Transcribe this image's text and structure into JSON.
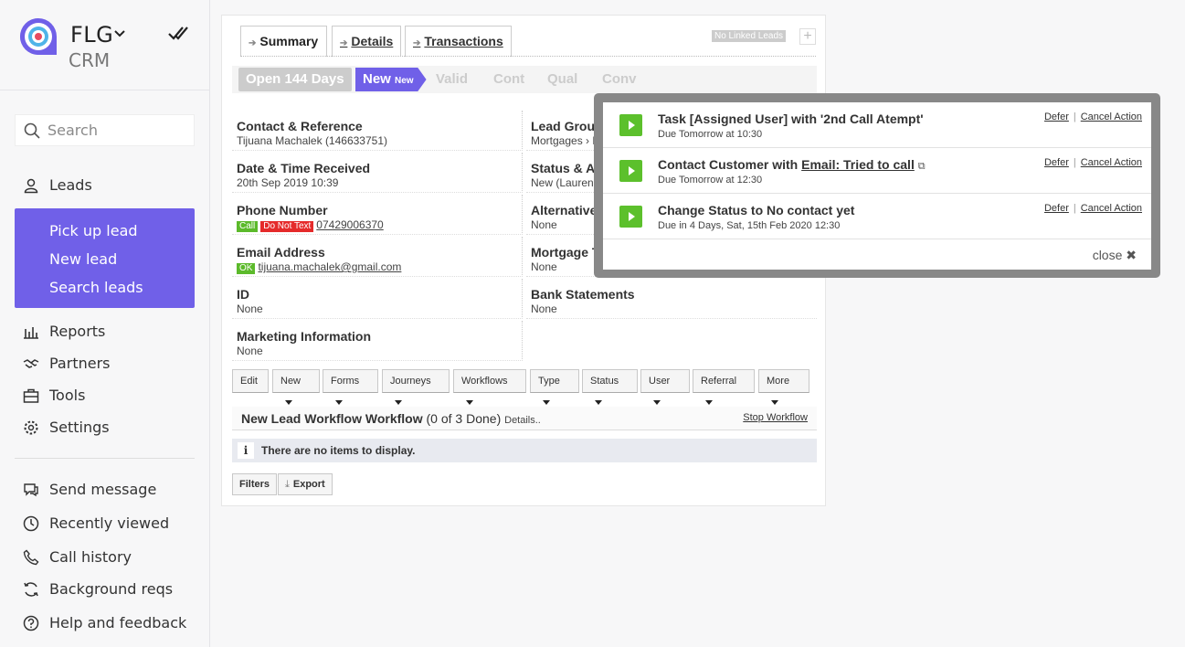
{
  "brand": {
    "name": "FLG",
    "sub": "CRM"
  },
  "search": {
    "placeholder": "Search"
  },
  "nav": {
    "leads": "Leads",
    "lead_items": [
      "Pick up lead",
      "New lead",
      "Search leads"
    ],
    "reports": "Reports",
    "partners": "Partners",
    "tools": "Tools",
    "settings": "Settings",
    "send_message": "Send message",
    "recently_viewed": "Recently viewed",
    "call_history": "Call history",
    "background_reqs": "Background reqs",
    "help": "Help and feedback"
  },
  "tabs": [
    "Summary",
    "Details",
    "Transactions"
  ],
  "no_linked": "No Linked Leads",
  "plus": "+",
  "stages": {
    "open": "Open 144 Days",
    "new": "New",
    "new_sub": "New",
    "others": [
      "Valid",
      "Cont",
      "Qual",
      "Conv"
    ]
  },
  "fields": {
    "contact_label": "Contact & Reference",
    "contact_value": "Tijuana Machalek (146633751)",
    "date_label": "Date & Time Received",
    "date_value": "20th Sep 2019 10:39",
    "phone_label": "Phone Number",
    "phone_call": "Call",
    "phone_dnt": "Do Not Text",
    "phone_value": "07429006370",
    "email_label": "Email Address",
    "email_ok": "OK",
    "email_value": "tijuana.machalek@gmail.com",
    "id_label": "ID",
    "id_value": "None",
    "marketing_label": "Marketing Information",
    "marketing_value": "None",
    "group_label": "Lead Group",
    "group_value": "Mortgages › Mo",
    "status_label": "Status & As",
    "status_value": "New (Lauren S",
    "alt_label": "Alternative P",
    "alt_value": "None",
    "mortgage_label": "Mortgage Ty",
    "mortgage_value": "None",
    "bank_label": "Bank Statements",
    "bank_value": "None"
  },
  "buttons": [
    "Edit",
    "New",
    "Forms",
    "Journeys",
    "Workflows",
    "Type",
    "Status",
    "User",
    "Referral",
    "More"
  ],
  "workflow": {
    "title": "New Lead Workflow Workflow",
    "count": "(0 of 3 Done)",
    "details": "Details..",
    "stop": "Stop Workflow"
  },
  "empty": {
    "icon": "i",
    "text": "There are no items to display."
  },
  "bottom": {
    "filters": "Filters",
    "export": "Export"
  },
  "popup": {
    "tasks": [
      {
        "title": "Task [Assigned User] with '2nd Call Atempt'",
        "due": "Due Tomorrow at 10:30"
      },
      {
        "title_pre": "Contact Customer with ",
        "title_link": "Email: Tried to call",
        "due": "Due Tomorrow at 12:30"
      },
      {
        "title": "Change Status to No contact yet",
        "due": "Due in 4 Days, Sat, 15th Feb 2020 12:30"
      }
    ],
    "defer": "Defer",
    "cancel": "Cancel Action",
    "close": "close ✖"
  },
  "colors": {
    "accent": "#7060e8",
    "green": "#5cc02c",
    "red": "#e52a2a"
  }
}
